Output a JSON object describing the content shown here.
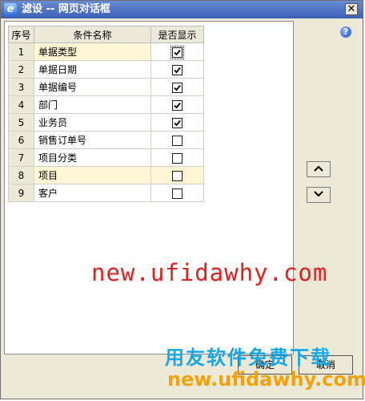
{
  "window": {
    "title": "滤设 -- 网页对话框",
    "close_glyph": "✕",
    "help_glyph": "?"
  },
  "table": {
    "headers": [
      "序号",
      "条件名称",
      "是否显示"
    ],
    "rows": [
      {
        "num": "1",
        "name": "单据类型",
        "checked": true
      },
      {
        "num": "2",
        "name": "单据日期",
        "checked": true
      },
      {
        "num": "3",
        "name": "单据编号",
        "checked": true
      },
      {
        "num": "4",
        "name": "部门",
        "checked": true
      },
      {
        "num": "5",
        "name": "业务员",
        "checked": true
      },
      {
        "num": "6",
        "name": "销售订单号",
        "checked": false
      },
      {
        "num": "7",
        "name": "项目分类",
        "checked": false
      },
      {
        "num": "8",
        "name": "项目",
        "checked": false
      },
      {
        "num": "9",
        "name": "客户",
        "checked": false
      }
    ]
  },
  "side_buttons": {
    "up_icon": "chevron-up-icon",
    "down_icon": "chevron-down-icon"
  },
  "footer": {
    "ok_label": "确定",
    "cancel_label": "取消"
  },
  "watermark": {
    "url": "new.ufidawhy.com",
    "brand": "用友软件免费下载",
    "brand_url": "new.ufidawhy.com"
  }
}
